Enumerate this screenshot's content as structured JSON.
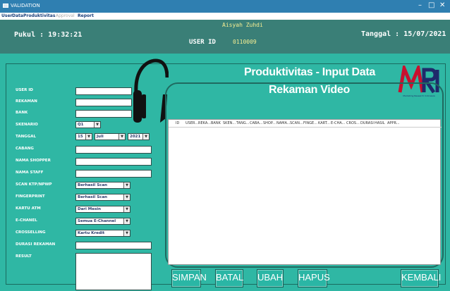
{
  "window": {
    "title": "VALIDATION",
    "controls": [
      "–",
      "□",
      "✕"
    ]
  },
  "menu": [
    {
      "label": "User",
      "enabled": true
    },
    {
      "label": "Data",
      "enabled": true
    },
    {
      "label": "Produktivitas",
      "enabled": true
    },
    {
      "label": "Approval",
      "enabled": false
    },
    {
      "label": "Report",
      "enabled": true
    }
  ],
  "header": {
    "time_label": "Pukul : 19:32:21",
    "user_name": "Aisyah Zuhdi",
    "user_id_label": "USER ID",
    "user_id_value": "0110009",
    "date_label": "Tanggal : 15/07/2021"
  },
  "page": {
    "title_line1": "Produktivitas - Input Data",
    "title_line2": "Rekaman Video"
  },
  "logo": {
    "text": "MRI",
    "tagline": "Marketing Research Indonesia",
    "colors": {
      "mark": "#c8102e",
      "text": "#1f2a6b"
    }
  },
  "icon": {
    "name": "headphones-icon"
  },
  "form": {
    "labels": {
      "user_id": "USER ID",
      "rekaman": "REKAMAN",
      "bank": "BANK",
      "skenario": "SKENARIO",
      "tanggal": "TANGGAL",
      "cabang": "CABANG",
      "nama_shopper": "NAMA SHOPPER",
      "nama_staff": "NAMA STAFF",
      "scan_ktp": "SCAN KTP/NPWP",
      "fingerprint": "FINGERPRINT",
      "kartu_atm": "KARTU ATM",
      "e_chanel": "E-CHANEL",
      "crosselling": "CROSSELLING",
      "durasi_rekaman": "DURASI REKAMAN",
      "result": "RESULT"
    },
    "values": {
      "skenario": "Q1",
      "tanggal_day": "15",
      "tanggal_month": "Juli",
      "tanggal_year": "2021",
      "scan_ktp": "Berhasil Scan",
      "fingerprint": "Berhasil Scan",
      "kartu_atm": "Dari Mesin",
      "e_chanel": "Semua E-Channel",
      "crosselling": "Kartu Kredit"
    },
    "dropdown_arrow": "▼"
  },
  "table": {
    "columns": [
      "ID",
      "USER...",
      "REKA...",
      "BANK",
      "SKEN...",
      "TANG...",
      "CABA...",
      "SHOP...",
      "NAMA...",
      "SCAN...",
      "FINGE...",
      "KART...",
      "E-CHA...",
      "CROS...",
      "DURASI",
      "HASIL",
      "APPR..."
    ]
  },
  "buttons": {
    "simpan": "SIMPAN",
    "batal": "BATAL",
    "ubah": "UBAH",
    "hapus": "HAPUS",
    "kembali": "KEMBALI"
  },
  "colors": {
    "header_bg": "#3a7f77",
    "main_bg": "#2fb7a4",
    "titlebar": "#2f7fb1",
    "user_name": "#f5ee93"
  }
}
